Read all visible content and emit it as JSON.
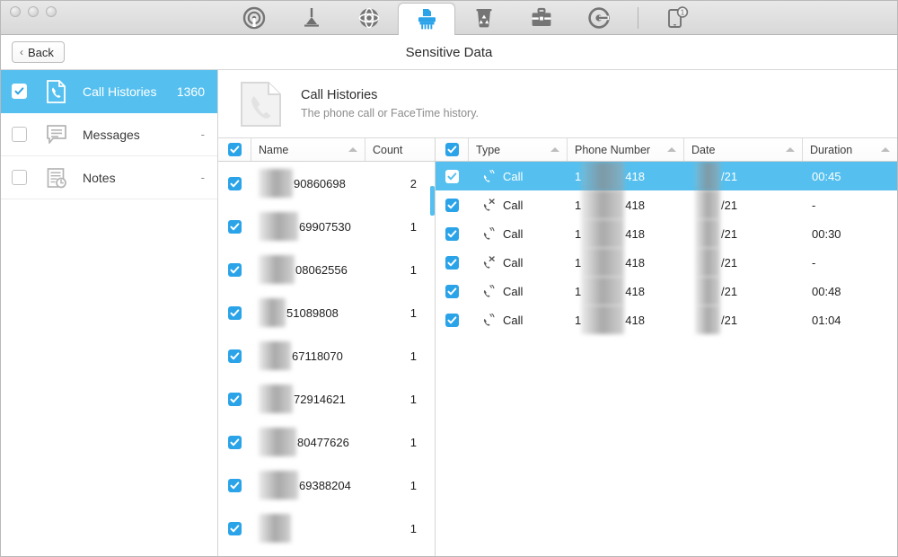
{
  "window": {
    "traffic_lights": [
      "close",
      "minimize",
      "zoom"
    ],
    "accent_color": "#55c0ef",
    "checkbox_color": "#2aa3e8"
  },
  "tabs": [
    {
      "name": "radar-tab",
      "icon": "radar-icon",
      "active": false
    },
    {
      "name": "cleaner-tab",
      "icon": "broom-icon",
      "active": false
    },
    {
      "name": "web-tab",
      "icon": "globe-icon",
      "active": false
    },
    {
      "name": "shredder-tab",
      "icon": "shredder-icon",
      "active": true
    },
    {
      "name": "trash-tab",
      "icon": "recycle-bin-icon",
      "active": false
    },
    {
      "name": "toolkit-tab",
      "icon": "toolbox-icon",
      "active": false
    },
    {
      "name": "optimize-tab",
      "icon": "target-icon",
      "active": false
    },
    {
      "name": "device-tab",
      "icon": "phone-icon",
      "active": false,
      "badge": "1"
    }
  ],
  "subheader": {
    "back_label": "Back",
    "back_chevron": "‹",
    "title": "Sensitive Data"
  },
  "sidebar": {
    "items": [
      {
        "label": "Call Histories",
        "count": "1360",
        "checked": true,
        "selected": true,
        "icon": "call-history-icon"
      },
      {
        "label": "Messages",
        "count": "-",
        "checked": false,
        "selected": false,
        "icon": "message-icon"
      },
      {
        "label": "Notes",
        "count": "-",
        "checked": false,
        "selected": false,
        "icon": "notes-icon"
      }
    ]
  },
  "main_header": {
    "icon": "call-history-doc-icon",
    "title": "Call Histories",
    "subtitle": "The phone call or FaceTime history."
  },
  "left_table": {
    "select_all_checked": true,
    "columns": [
      {
        "label": "Name",
        "sortable": true
      },
      {
        "label": "Count",
        "sortable": false
      }
    ],
    "rows": [
      {
        "name_blurred": true,
        "name": "90860698",
        "count": "2",
        "checked": true
      },
      {
        "name_blurred": true,
        "name": "69907530",
        "count": "1",
        "checked": true
      },
      {
        "name_blurred": true,
        "name": "08062556",
        "count": "1",
        "checked": true
      },
      {
        "name_blurred": true,
        "name": "51089808",
        "count": "1",
        "checked": true
      },
      {
        "name_blurred": true,
        "name": "67118070",
        "count": "1",
        "checked": true
      },
      {
        "name_blurred": true,
        "name": "72914621",
        "count": "1",
        "checked": true
      },
      {
        "name_blurred": true,
        "name": "80477626",
        "count": "1",
        "checked": true
      },
      {
        "name_blurred": true,
        "name": "69388204",
        "count": "1",
        "checked": true
      },
      {
        "name_blurred": true,
        "name": "",
        "count": "1",
        "checked": true
      }
    ],
    "scrollbar_visible": true
  },
  "right_table": {
    "select_all_checked": true,
    "columns": [
      {
        "label": "Type",
        "sortable": true
      },
      {
        "label": "Phone Number",
        "sortable": true
      },
      {
        "label": "Date",
        "sortable": true
      },
      {
        "label": "Duration",
        "sortable": true
      }
    ],
    "rows": [
      {
        "type": "Call",
        "icon": "incoming-call-icon",
        "phone_prefix": "1",
        "phone_suffix": "418",
        "date_suffix": "/21",
        "duration": "00:45",
        "checked": true,
        "selected": true
      },
      {
        "type": "Call",
        "icon": "missed-call-icon",
        "phone_prefix": "1",
        "phone_suffix": "418",
        "date_suffix": "/21",
        "duration": "-",
        "checked": true,
        "selected": false
      },
      {
        "type": "Call",
        "icon": "incoming-call-icon",
        "phone_prefix": "1",
        "phone_suffix": "418",
        "date_suffix": "/21",
        "duration": "00:30",
        "checked": true,
        "selected": false
      },
      {
        "type": "Call",
        "icon": "missed-call-icon",
        "phone_prefix": "1",
        "phone_suffix": "418",
        "date_suffix": "/21",
        "duration": "-",
        "checked": true,
        "selected": false
      },
      {
        "type": "Call",
        "icon": "incoming-call-icon",
        "phone_prefix": "1",
        "phone_suffix": "418",
        "date_suffix": "/21",
        "duration": "00:48",
        "checked": true,
        "selected": false
      },
      {
        "type": "Call",
        "icon": "incoming-call-icon",
        "phone_prefix": "1",
        "phone_suffix": "418",
        "date_suffix": "/21",
        "duration": "01:04",
        "checked": true,
        "selected": false
      }
    ]
  }
}
